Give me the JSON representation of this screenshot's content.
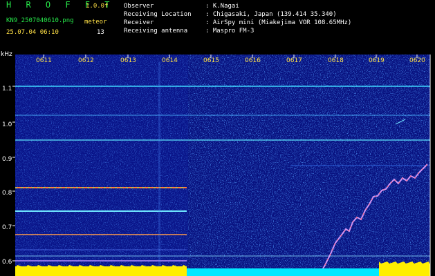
{
  "header": {
    "brand": "H R O F F T",
    "version": "1.0.0f",
    "filename": "KN9_2507040610.png",
    "meteor_label": "meteor",
    "timestamp": "25.07.04 06:10",
    "meteor_count": "13",
    "info": [
      {
        "label": "Observer",
        "value": ": K.Nagai"
      },
      {
        "label": "Receiving Location",
        "value": ": Chigasaki, Japan (139.414 35.340)"
      },
      {
        "label": "Receiver",
        "value": ": AirSpy mini (Miakejima VOR 108.65MHz)"
      },
      {
        "label": "Receiving antenna",
        "value": ": Maspro FM-3"
      }
    ]
  },
  "axis": {
    "unit": "kHz",
    "y_ticks": [
      "1.1",
      "1.0",
      "0.9",
      "0.8",
      "0.7",
      "0.6"
    ],
    "x_ticks": [
      "0611",
      "0612",
      "0613",
      "0614",
      "0615",
      "0616",
      "0617",
      "0618",
      "0619",
      "0620"
    ]
  },
  "colors": {
    "background": "#000000",
    "plot_noise": "#0a1590",
    "brand": "#27e84a",
    "label_yellow": "#ffe046",
    "bar_yellow": "#ffee00",
    "bar_cyan": "#00e8ff"
  }
}
